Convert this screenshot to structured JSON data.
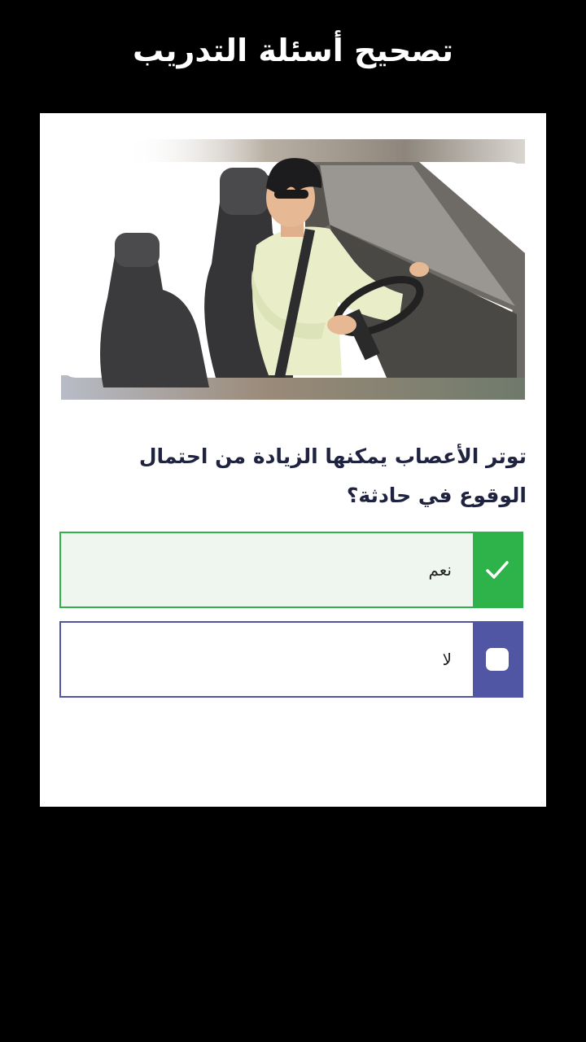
{
  "header": {
    "title": "تصحيح أسئلة التدريب"
  },
  "question": {
    "text": "توتر الأعصاب يمكنها الزيادة من احتمال الوقوع في حادثة؟"
  },
  "options": [
    {
      "label": "نعم",
      "state": "correct",
      "icon": "check-icon"
    },
    {
      "label": "لا",
      "state": "unselected",
      "icon": "checkbox-icon"
    }
  ],
  "colors": {
    "correct": "#2db34a",
    "correct_bg": "#eef6ef",
    "neutral": "#5156a4",
    "question_text": "#1f2340"
  }
}
